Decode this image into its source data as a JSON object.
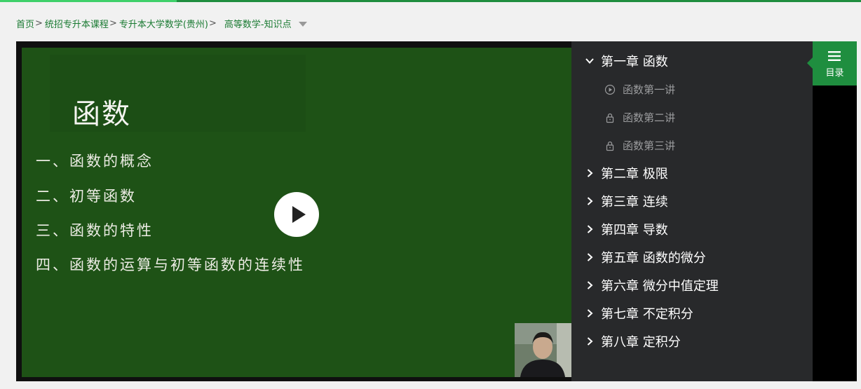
{
  "breadcrumb": {
    "items": [
      "首页",
      "统招专升本课程",
      "专升本大学数学(贵州)"
    ],
    "separator": ">",
    "current": "高等数学-知识点"
  },
  "video": {
    "slide_title": "函数",
    "slide_lines": [
      "一、函数的概念",
      "二、初等函数",
      "三、函数的特性",
      "四、函数的运算与初等函数的连续性"
    ]
  },
  "sidebar": {
    "chapters": [
      {
        "label": "第一章 函数",
        "expanded": true,
        "lessons": [
          {
            "label": "函数第一讲",
            "icon": "play-circle-icon"
          },
          {
            "label": "函数第二讲",
            "icon": "lock-icon"
          },
          {
            "label": "函数第三讲",
            "icon": "lock-icon"
          }
        ]
      },
      {
        "label": "第二章 极限",
        "expanded": false
      },
      {
        "label": "第三章 连续",
        "expanded": false
      },
      {
        "label": "第四章 导数",
        "expanded": false
      },
      {
        "label": "第五章 函数的微分",
        "expanded": false
      },
      {
        "label": "第六章 微分中值定理",
        "expanded": false
      },
      {
        "label": "第七章 不定积分",
        "expanded": false
      },
      {
        "label": "第八章 定积分",
        "expanded": false
      }
    ]
  },
  "toc": {
    "label": "目录"
  },
  "colors": {
    "accent": "#1f8e3f",
    "board": "#1e5216",
    "sidebar_bg": "#28292b"
  }
}
